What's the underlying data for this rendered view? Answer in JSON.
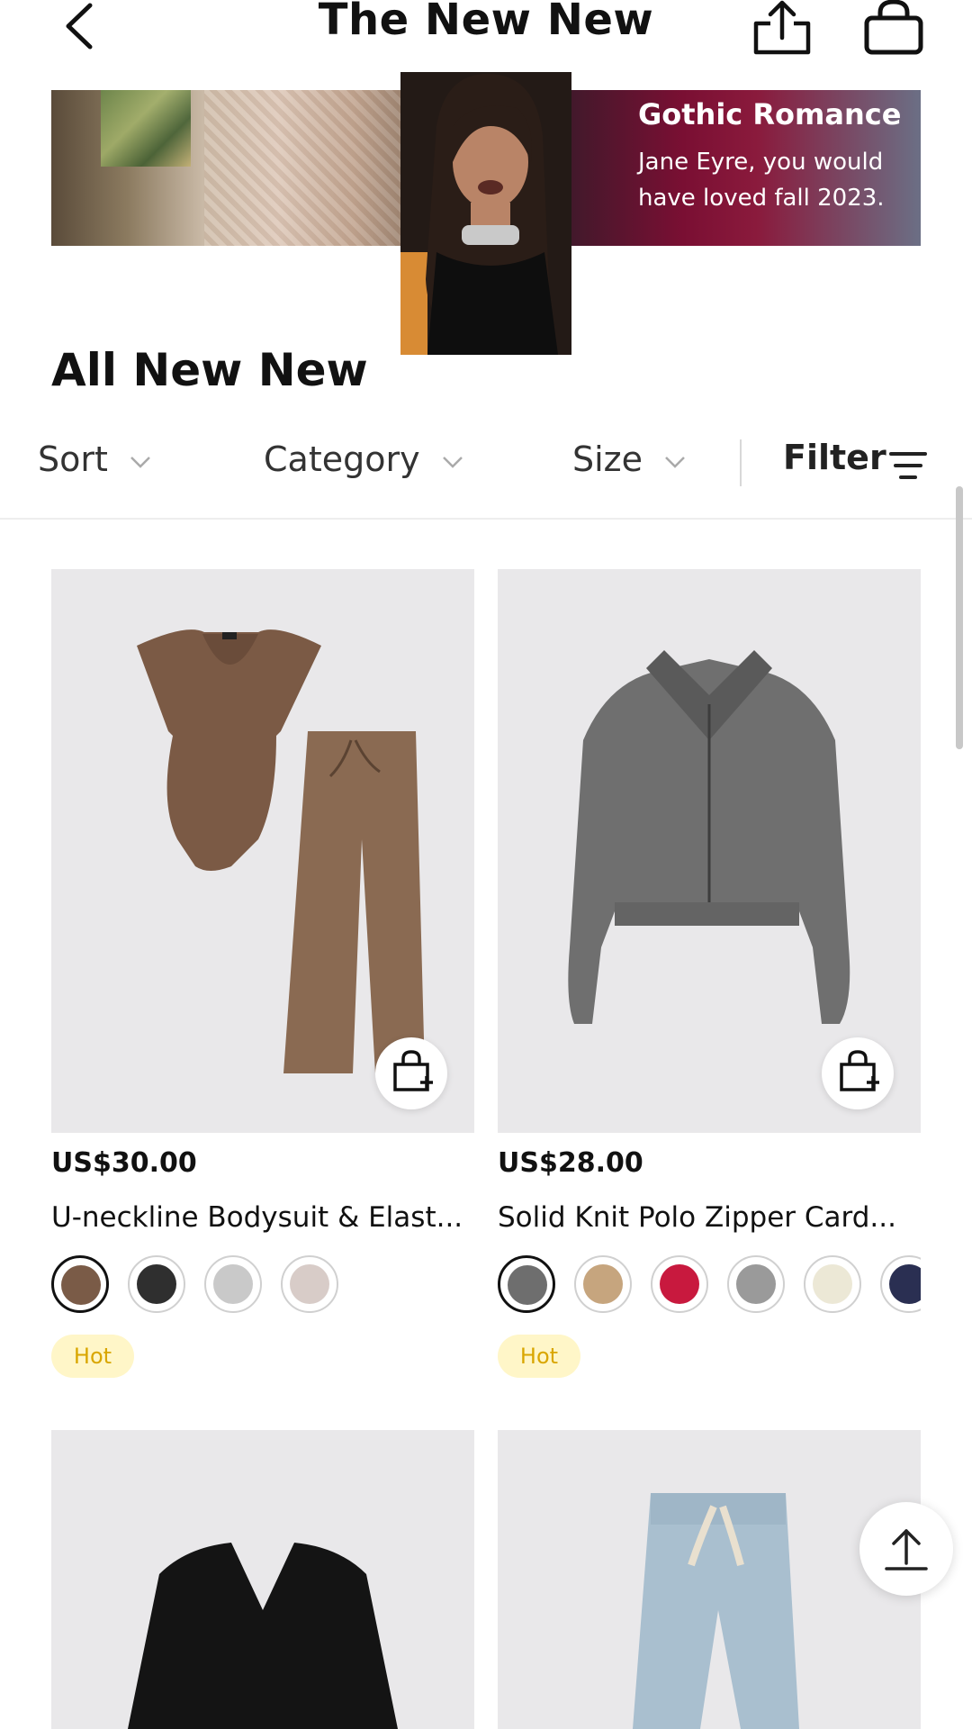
{
  "header": {
    "title": "The New New"
  },
  "banner": {
    "promo_title": "Gothic Romance",
    "promo_subtitle": "Jane Eyre, you would have loved fall 2023."
  },
  "section": {
    "title": "All New New"
  },
  "filters": {
    "sort": "Sort",
    "category": "Category",
    "size": "Size",
    "filter": "Filter"
  },
  "products": [
    {
      "price": "US$30.00",
      "name": "U-neckline Bodysuit & Elast...",
      "badge": "Hot",
      "swatches": [
        "#7a5b47",
        "#2f2f2f",
        "#c9c9c9",
        "#d8ccc8"
      ]
    },
    {
      "price": "US$28.00",
      "name": "Solid Knit Polo Zipper Card...",
      "badge": "Hot",
      "swatches": [
        "#6e6e6e",
        "#c6a57e",
        "#c8193e",
        "#9a9a9a",
        "#ece8d6",
        "#2a2f52"
      ]
    }
  ],
  "colors": {
    "promo_gradient_mid": "#7a0f33",
    "hot_badge_bg": "#fff6c8",
    "hot_badge_text": "#d9a600",
    "card_bg": "#e9e8ea"
  }
}
